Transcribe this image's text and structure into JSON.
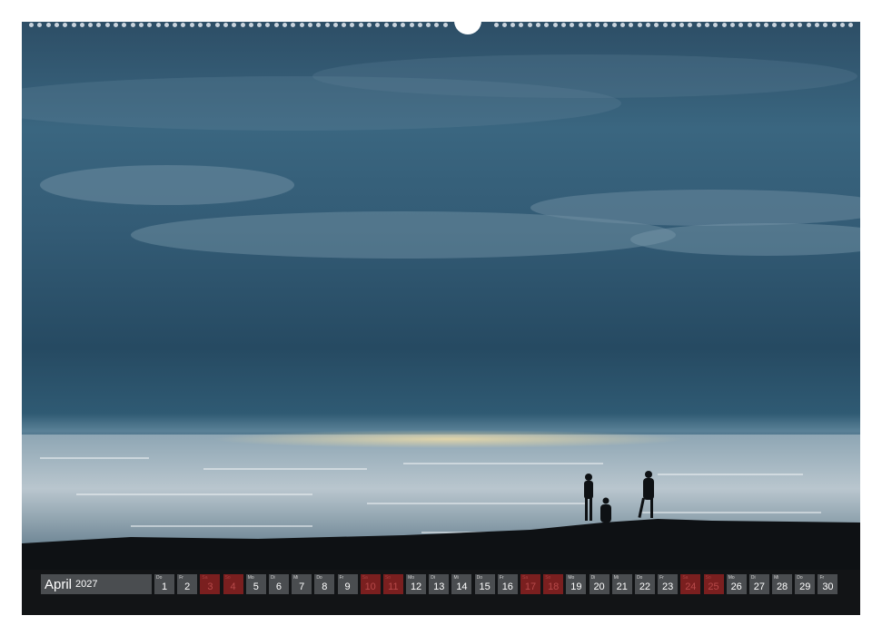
{
  "calendar": {
    "month": "April",
    "year": "2027",
    "days": [
      {
        "wd": "Do",
        "d": "1",
        "holiday": false
      },
      {
        "wd": "Fr",
        "d": "2",
        "holiday": false
      },
      {
        "wd": "Sa",
        "d": "3",
        "holiday": true
      },
      {
        "wd": "So",
        "d": "4",
        "holiday": true
      },
      {
        "wd": "Mo",
        "d": "5",
        "holiday": false
      },
      {
        "wd": "Di",
        "d": "6",
        "holiday": false
      },
      {
        "wd": "Mi",
        "d": "7",
        "holiday": false
      },
      {
        "wd": "Do",
        "d": "8",
        "holiday": false
      },
      {
        "wd": "Fr",
        "d": "9",
        "holiday": false
      },
      {
        "wd": "Sa",
        "d": "10",
        "holiday": true
      },
      {
        "wd": "So",
        "d": "11",
        "holiday": true
      },
      {
        "wd": "Mo",
        "d": "12",
        "holiday": false
      },
      {
        "wd": "Di",
        "d": "13",
        "holiday": false
      },
      {
        "wd": "Mi",
        "d": "14",
        "holiday": false
      },
      {
        "wd": "Do",
        "d": "15",
        "holiday": false
      },
      {
        "wd": "Fr",
        "d": "16",
        "holiday": false
      },
      {
        "wd": "Sa",
        "d": "17",
        "holiday": true
      },
      {
        "wd": "So",
        "d": "18",
        "holiday": true
      },
      {
        "wd": "Mo",
        "d": "19",
        "holiday": false
      },
      {
        "wd": "Di",
        "d": "20",
        "holiday": false
      },
      {
        "wd": "Mi",
        "d": "21",
        "holiday": false
      },
      {
        "wd": "Do",
        "d": "22",
        "holiday": false
      },
      {
        "wd": "Fr",
        "d": "23",
        "holiday": false
      },
      {
        "wd": "Sa",
        "d": "24",
        "holiday": true
      },
      {
        "wd": "So",
        "d": "25",
        "holiday": true
      },
      {
        "wd": "Mo",
        "d": "26",
        "holiday": false
      },
      {
        "wd": "Di",
        "d": "27",
        "holiday": false
      },
      {
        "wd": "Mi",
        "d": "28",
        "holiday": false
      },
      {
        "wd": "Do",
        "d": "29",
        "holiday": false
      },
      {
        "wd": "Fr",
        "d": "30",
        "holiday": false
      }
    ]
  },
  "colors": {
    "sky": "#2f5a73",
    "sea_glint": "#d9dde0",
    "land": "#0e1114",
    "day_cell": "#4a4d50",
    "holiday_cell": "#7a1f1f"
  }
}
